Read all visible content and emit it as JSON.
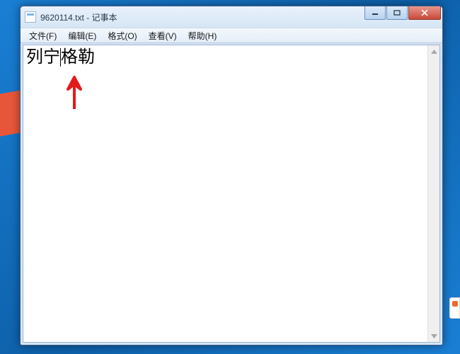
{
  "window": {
    "title": "9620114.txt - 记事本"
  },
  "menubar": {
    "file": "文件(F)",
    "edit": "编辑(E)",
    "format": "格式(O)",
    "view": "查看(V)",
    "help": "帮助(H)"
  },
  "editor": {
    "text_before_caret": "列宁",
    "text_after_caret": "格勒"
  }
}
